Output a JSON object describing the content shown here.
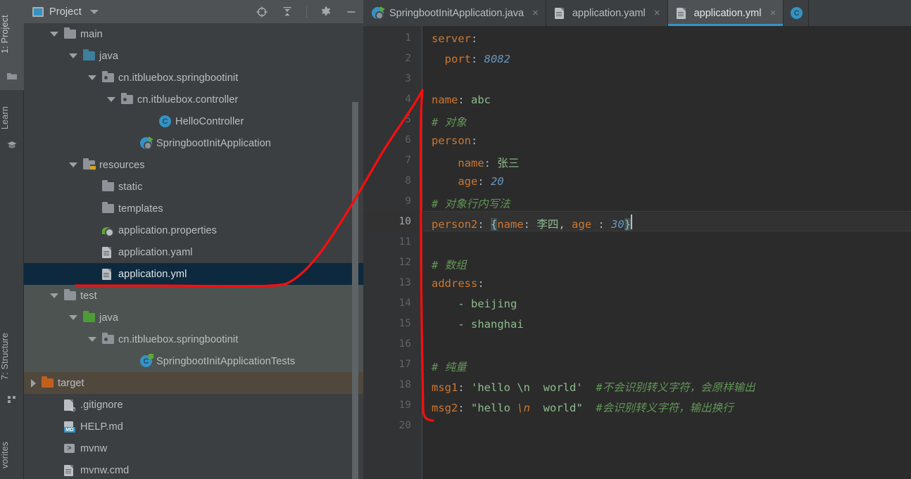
{
  "window": {
    "tool_stripe": [
      {
        "label": "1: Project",
        "icon": "folder-icon"
      },
      {
        "label": "Learn",
        "icon": "graduation-cap-icon"
      },
      {
        "label": "7: Structure",
        "icon": "structure-icon"
      },
      {
        "label": "vorites",
        "icon": "star-icon"
      }
    ]
  },
  "project_panel": {
    "title": "Project",
    "title_icon": "project-view-icon",
    "dropdown_icon": "chevron-down-icon",
    "toolbar": [
      {
        "name": "select-opened-file-icon",
        "tooltip": "Select Opened File"
      },
      {
        "name": "collapse-all-icon",
        "tooltip": "Collapse All"
      },
      {
        "name": "gear-icon",
        "tooltip": "Settings"
      },
      {
        "name": "minimize-icon",
        "tooltip": "Hide"
      }
    ],
    "tree": [
      {
        "label": "main",
        "indent": 2,
        "arrow": "down",
        "icon": "folder-gray",
        "state": "normal"
      },
      {
        "label": "java",
        "indent": 3,
        "arrow": "down",
        "icon": "folder-blue",
        "state": "normal"
      },
      {
        "label": "cn.itbluebox.springbootinit",
        "indent": 4,
        "arrow": "down",
        "icon": "package-icon",
        "state": "normal"
      },
      {
        "label": "cn.itbluebox.controller",
        "indent": 5,
        "arrow": "down",
        "icon": "package-icon",
        "state": "normal"
      },
      {
        "label": "HelloController",
        "indent": 7,
        "arrow": "none",
        "icon": "java-class-icon",
        "state": "normal"
      },
      {
        "label": "SpringbootInitApplication",
        "indent": 6,
        "arrow": "none",
        "icon": "spring-boot-icon",
        "state": "normal"
      },
      {
        "label": "resources",
        "indent": 3,
        "arrow": "down",
        "icon": "resources-folder",
        "state": "normal"
      },
      {
        "label": "static",
        "indent": 4,
        "arrow": "none",
        "icon": "folder-gray",
        "state": "normal"
      },
      {
        "label": "templates",
        "indent": 4,
        "arrow": "none",
        "icon": "folder-gray",
        "state": "normal"
      },
      {
        "label": "application.properties",
        "indent": 4,
        "arrow": "none",
        "icon": "spring-leaf-icon",
        "state": "normal"
      },
      {
        "label": "application.yaml",
        "indent": 4,
        "arrow": "none",
        "icon": "yaml-file-icon",
        "state": "normal"
      },
      {
        "label": "application.yml",
        "indent": 4,
        "arrow": "none",
        "icon": "yaml-file-icon",
        "state": "selected"
      },
      {
        "label": "test",
        "indent": 2,
        "arrow": "down",
        "icon": "folder-gray",
        "state": "test"
      },
      {
        "label": "java",
        "indent": 3,
        "arrow": "down",
        "icon": "folder-green",
        "state": "test"
      },
      {
        "label": "cn.itbluebox.springbootinit",
        "indent": 4,
        "arrow": "down",
        "icon": "package-icon",
        "state": "test"
      },
      {
        "label": "SpringbootInitApplicationTests",
        "indent": 6,
        "arrow": "none",
        "icon": "java-test-class-icon",
        "state": "test"
      },
      {
        "label": "target",
        "indent": 1,
        "arrow": "right",
        "icon": "folder-orange",
        "state": "target"
      },
      {
        "label": ".gitignore",
        "indent": 2,
        "arrow": "none",
        "icon": "gitignore-icon",
        "state": "normal"
      },
      {
        "label": "HELP.md",
        "indent": 2,
        "arrow": "none",
        "icon": "markdown-file-icon",
        "state": "normal"
      },
      {
        "label": "mvnw",
        "indent": 2,
        "arrow": "none",
        "icon": "shell-script-icon",
        "state": "normal"
      },
      {
        "label": "mvnw.cmd",
        "indent": 2,
        "arrow": "none",
        "icon": "cmd-file-icon",
        "state": "normal"
      }
    ]
  },
  "editor": {
    "tabs": [
      {
        "label": "SpringbootInitApplication.java",
        "icon": "spring-boot-icon",
        "active": false,
        "close": "×"
      },
      {
        "label": "application.yaml",
        "icon": "yaml-file-icon",
        "active": false,
        "close": "×"
      },
      {
        "label": "application.yml",
        "icon": "yaml-file-icon",
        "active": true,
        "close": "×"
      },
      {
        "label": "",
        "icon": "java-class-icon",
        "active": false,
        "close": ""
      }
    ],
    "current_line": 10,
    "line_numbers": [
      "1",
      "2",
      "3",
      "4",
      "5",
      "6",
      "7",
      "8",
      "9",
      "10",
      "11",
      "12",
      "13",
      "14",
      "15",
      "16",
      "17",
      "18",
      "19",
      "20"
    ],
    "lines": [
      {
        "n": 1,
        "segments": [
          {
            "t": "server",
            "c": "k"
          },
          {
            "t": ":",
            "c": "pn"
          }
        ]
      },
      {
        "n": 2,
        "segments": [
          {
            "t": "  ",
            "c": "pn"
          },
          {
            "t": "port",
            "c": "k"
          },
          {
            "t": ": ",
            "c": "pn"
          },
          {
            "t": "8082",
            "c": "n"
          }
        ]
      },
      {
        "n": 3,
        "segments": []
      },
      {
        "n": 4,
        "segments": [
          {
            "t": "name",
            "c": "k"
          },
          {
            "t": ": ",
            "c": "pn"
          },
          {
            "t": "abc",
            "c": "v"
          }
        ]
      },
      {
        "n": 5,
        "segments": [
          {
            "t": "# 对象",
            "c": "cm"
          }
        ]
      },
      {
        "n": 6,
        "segments": [
          {
            "t": "person",
            "c": "k"
          },
          {
            "t": ":",
            "c": "pn"
          }
        ]
      },
      {
        "n": 7,
        "segments": [
          {
            "t": "    ",
            "c": "pn"
          },
          {
            "t": "name",
            "c": "k"
          },
          {
            "t": ": ",
            "c": "pn"
          },
          {
            "t": "张三",
            "c": "v"
          }
        ]
      },
      {
        "n": 8,
        "segments": [
          {
            "t": "    ",
            "c": "pn"
          },
          {
            "t": "age",
            "c": "k"
          },
          {
            "t": ": ",
            "c": "pn"
          },
          {
            "t": "20",
            "c": "n"
          }
        ]
      },
      {
        "n": 9,
        "segments": [
          {
            "t": "# 对象行内写法",
            "c": "cm"
          }
        ]
      },
      {
        "n": 10,
        "segments": [
          {
            "t": "person2",
            "c": "k"
          },
          {
            "t": ": ",
            "c": "pn"
          },
          {
            "t": "{",
            "c": "brace-hl"
          },
          {
            "t": "name",
            "c": "k"
          },
          {
            "t": ": ",
            "c": "pn"
          },
          {
            "t": "李四",
            "c": "v"
          },
          {
            "t": ", ",
            "c": "pn"
          },
          {
            "t": "age",
            "c": "k"
          },
          {
            "t": " : ",
            "c": "pn"
          },
          {
            "t": "30",
            "c": "n"
          },
          {
            "t": "}",
            "c": "brace-hl"
          }
        ]
      },
      {
        "n": 11,
        "segments": []
      },
      {
        "n": 12,
        "segments": [
          {
            "t": "# 数组",
            "c": "cm"
          }
        ]
      },
      {
        "n": 13,
        "segments": [
          {
            "t": "address",
            "c": "k"
          },
          {
            "t": ":",
            "c": "pn"
          }
        ]
      },
      {
        "n": 14,
        "segments": [
          {
            "t": "    ",
            "c": "pn"
          },
          {
            "t": "- ",
            "c": "v"
          },
          {
            "t": "beijing",
            "c": "v"
          }
        ]
      },
      {
        "n": 15,
        "segments": [
          {
            "t": "    ",
            "c": "pn"
          },
          {
            "t": "- ",
            "c": "v"
          },
          {
            "t": "shanghai",
            "c": "v"
          }
        ]
      },
      {
        "n": 16,
        "segments": []
      },
      {
        "n": 17,
        "segments": [
          {
            "t": "# 纯量",
            "c": "cm"
          }
        ]
      },
      {
        "n": 18,
        "segments": [
          {
            "t": "msg1",
            "c": "k"
          },
          {
            "t": ": ",
            "c": "pn"
          },
          {
            "t": "'hello \\n  world'",
            "c": "v"
          },
          {
            "t": "  ",
            "c": "pn"
          },
          {
            "t": "#不会识别转义字符，会原样输出",
            "c": "cm"
          }
        ]
      },
      {
        "n": 19,
        "segments": [
          {
            "t": "msg2",
            "c": "k"
          },
          {
            "t": ": ",
            "c": "pn"
          },
          {
            "t": "\"hello ",
            "c": "v"
          },
          {
            "t": "\\n",
            "c": "esc"
          },
          {
            "t": "  world\"",
            "c": "v"
          },
          {
            "t": "  ",
            "c": "pn"
          },
          {
            "t": "#会识别转义字符，输出换行",
            "c": "cm"
          }
        ]
      },
      {
        "n": 20,
        "segments": []
      }
    ]
  },
  "annotation": {
    "color": "#fc0d0d",
    "description": "hand-drawn red arrow from application.yml tree node up to editor gutter"
  },
  "colors": {
    "accent": "#3592c4",
    "selection": "#0d293e",
    "editor_bg": "#2b2b2b",
    "panel_bg": "#3c3f41",
    "gutter_bg": "#313335",
    "key": "#cc7832",
    "string": "#8fbc8f",
    "number": "#6897bb",
    "comment": "#629755"
  }
}
